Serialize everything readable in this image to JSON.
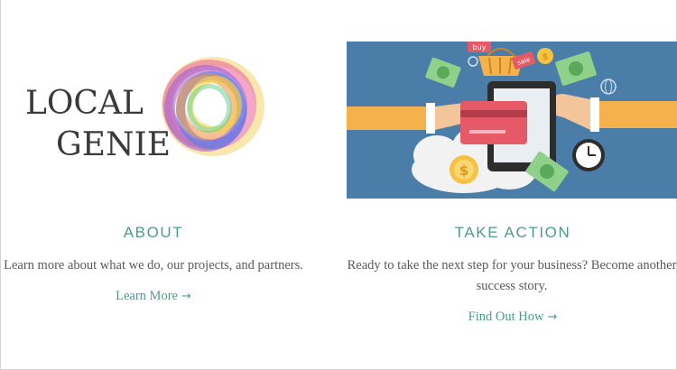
{
  "logo": {
    "line1": "LOCAL",
    "line2": "GENIE"
  },
  "about": {
    "heading": "ABOUT",
    "text": "Learn more about what we do, our projects, and partners.",
    "link_label": "Learn More",
    "link_arrow": "→"
  },
  "action": {
    "heading": "TAKE ACTION",
    "text_line1": "Ready to take the next step for your business? Become another",
    "text_line2": "success story.",
    "link_label": "Find Out How",
    "link_arrow": "→"
  },
  "hero": {
    "tag_buy": "buy",
    "tag_sale": "sale",
    "coin_symbol": "$"
  },
  "colors": {
    "accent": "#4e9c8c",
    "body_text": "#595959",
    "hero_bg": "#4a7ea9"
  }
}
